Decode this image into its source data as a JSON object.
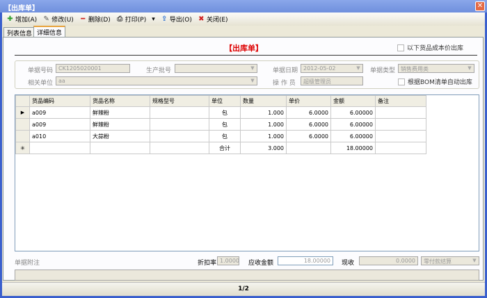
{
  "window": {
    "title": "【出库单】",
    "close_icon": "close-icon"
  },
  "toolbar": [
    {
      "label": "增加(A)",
      "icon": "plus-icon",
      "color": "#2a9d2a"
    },
    {
      "label": "修改(U)",
      "icon": "edit-icon",
      "color": "#555"
    },
    {
      "label": "删除(D)",
      "icon": "minus-icon",
      "color": "#d02020"
    },
    {
      "label": "打印(P)",
      "icon": "printer-icon",
      "color": "#444"
    },
    {
      "label": "导出(O)",
      "icon": "export-icon",
      "color": "#2a6fd0"
    },
    {
      "label": "关闭(E)",
      "icon": "close-circle-icon",
      "color": "#d02020"
    }
  ],
  "tabs": [
    "列表信息",
    "详细信息"
  ],
  "doc_title": "【出库单】",
  "cost_price_checkbox": "以下货品成本价出库",
  "bom_checkbox": "根据BOM清单自动出库",
  "form": {
    "doc_no_label": "单据号码",
    "doc_no": "CK1205020001",
    "batch_label": "生产批号",
    "batch": "",
    "date_label": "单据日期",
    "date": "2012-05-02",
    "type_label": "单据类型",
    "type": "销售费用类",
    "unit_label": "相关单位",
    "unit": "aa",
    "operator_label": "操 作 员",
    "operator": "超级管理员"
  },
  "grid": {
    "columns": [
      "货品编码",
      "货品名称",
      "规格型号",
      "单位",
      "数量",
      "单价",
      "金额",
      "备注"
    ],
    "rows": [
      [
        "a009",
        "鲜辣粉",
        "",
        "包",
        "1.000",
        "6.0000",
        "6.00000",
        ""
      ],
      [
        "a009",
        "鲜辣粉",
        "",
        "包",
        "1.000",
        "6.0000",
        "6.00000",
        ""
      ],
      [
        "a010",
        "大蒜粉",
        "",
        "包",
        "1.000",
        "6.0000",
        "6.00000",
        ""
      ]
    ],
    "total": {
      "label": "合计",
      "qty": "3.000",
      "amount": "18.00000"
    }
  },
  "footer": {
    "memo_label": "单据附注",
    "discount_label": "折扣率",
    "discount": "1.0000",
    "receivable_label": "应收金额",
    "receivable": "18.00000",
    "cash_label": "现收",
    "cash": "0.0000",
    "settle": "零付款结算"
  },
  "status": {
    "page": "1/2"
  }
}
